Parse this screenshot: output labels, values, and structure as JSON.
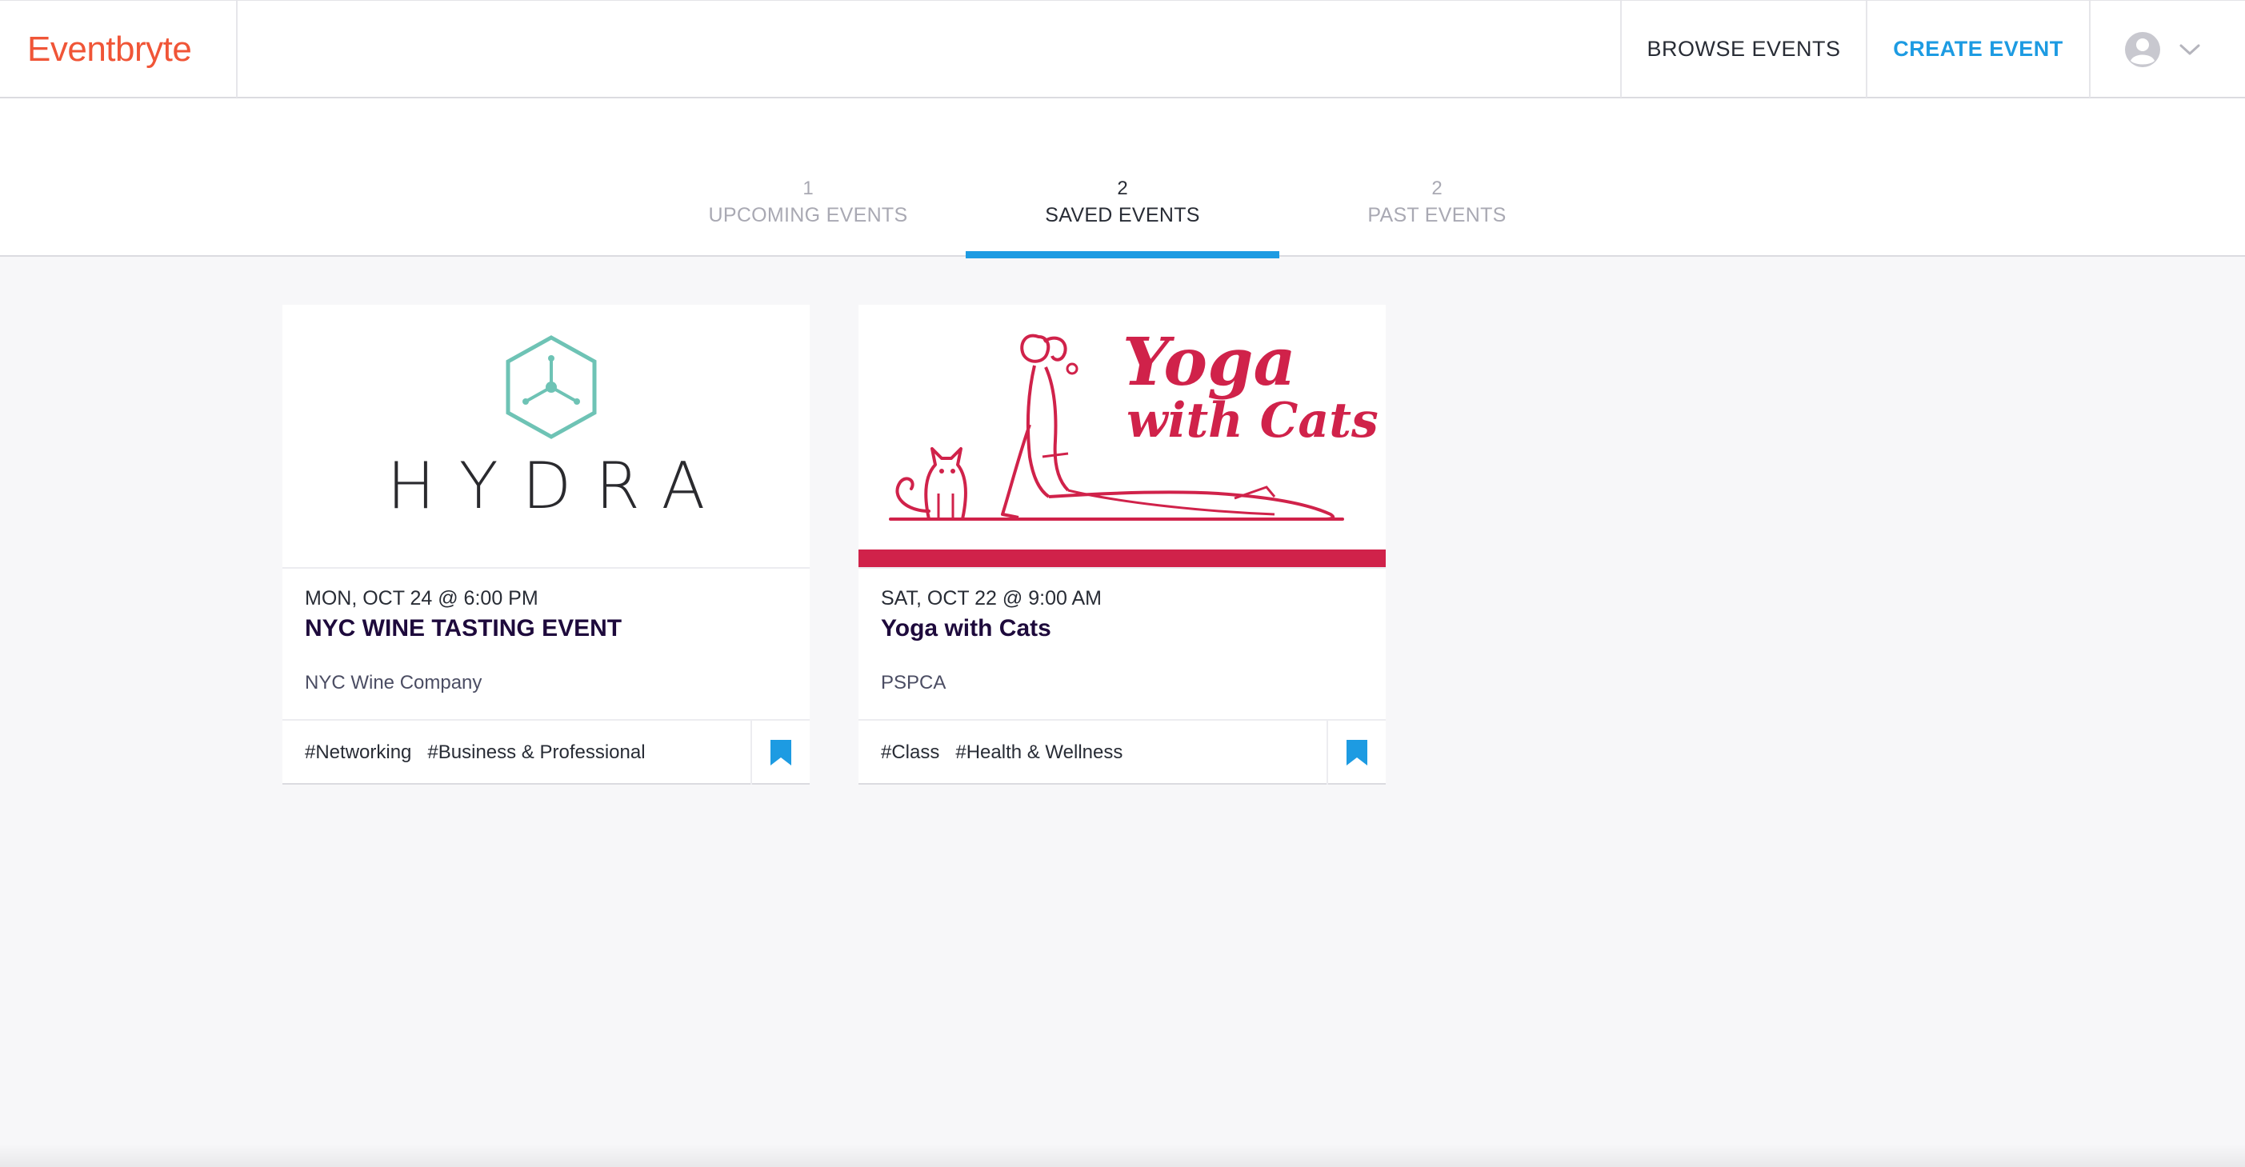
{
  "header": {
    "logo": "Eventbryte",
    "browse_label": "BROWSE EVENTS",
    "create_label": "CREATE EVENT",
    "user_icon": "user-avatar-icon",
    "dropdown_icon": "chevron-down-icon"
  },
  "tabs": [
    {
      "count": "1",
      "label": "UPCOMING EVENTS",
      "active": false
    },
    {
      "count": "2",
      "label": "SAVED EVENTS",
      "active": true
    },
    {
      "count": "2",
      "label": "PAST EVENTS",
      "active": false
    }
  ],
  "events": [
    {
      "image_text": "HYDRA",
      "date": "MON, OCT 24 @ 6:00 PM",
      "title": "NYC WINE TASTING EVENT",
      "organizer": "NYC Wine Company",
      "tags": [
        "#Networking",
        "#Business & Professional"
      ],
      "saved": true
    },
    {
      "image_text_line1": "Yoga",
      "image_text_line2": "with Cats",
      "date": "SAT, OCT 22 @ 9:00 AM",
      "title": "Yoga with Cats",
      "organizer": "PSPCA",
      "tags": [
        "#Class",
        "#Health & Wellness"
      ],
      "saved": true
    }
  ],
  "colors": {
    "brand": "#f05537",
    "accent": "#1d9be2",
    "hydra_teal": "#6ec3b5",
    "yoga_red": "#d0224a",
    "page_bg": "#f7f7f9"
  }
}
